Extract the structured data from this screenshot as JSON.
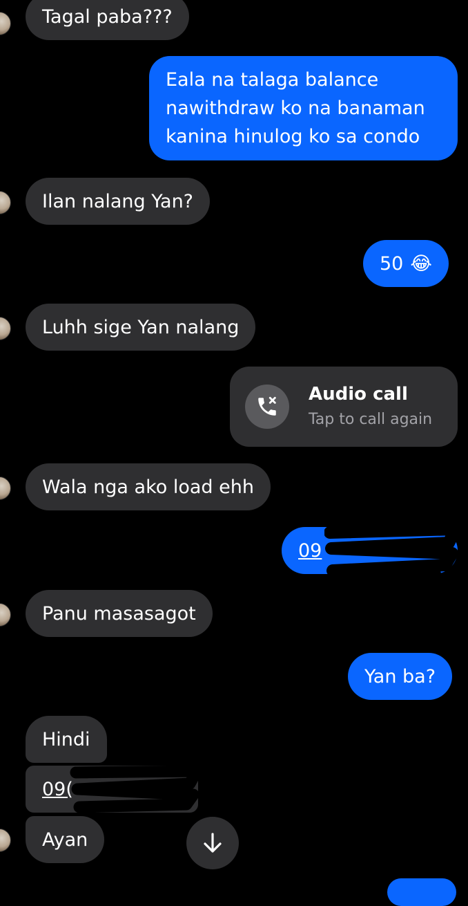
{
  "messages": {
    "m1": "Tagal paba???",
    "m2_line1": "Eala na talaga balance",
    "m2_line2": "nawithdraw ko na banaman",
    "m2_line3": "kanina hinulog ko sa condo",
    "m3": "Ilan nalang Yan?",
    "m4_text": "50",
    "m4_emoji": "😂",
    "m5": "Luhh sige Yan nalang",
    "call_title": "Audio call",
    "call_subtitle": "Tap to call again",
    "m6": "Wala nga ako load ehh",
    "m7_link": "09",
    "m8": "Panu masasagot",
    "m9": "Yan ba?",
    "m10": "Hindi",
    "m11_link": "09(",
    "m12": "Ayan"
  },
  "icons": {
    "call": "missed-call-icon",
    "scroll": "arrow-down-icon"
  },
  "colors": {
    "outgoing": "#0a66ff",
    "incoming": "#2f2f31",
    "background": "#000000"
  }
}
